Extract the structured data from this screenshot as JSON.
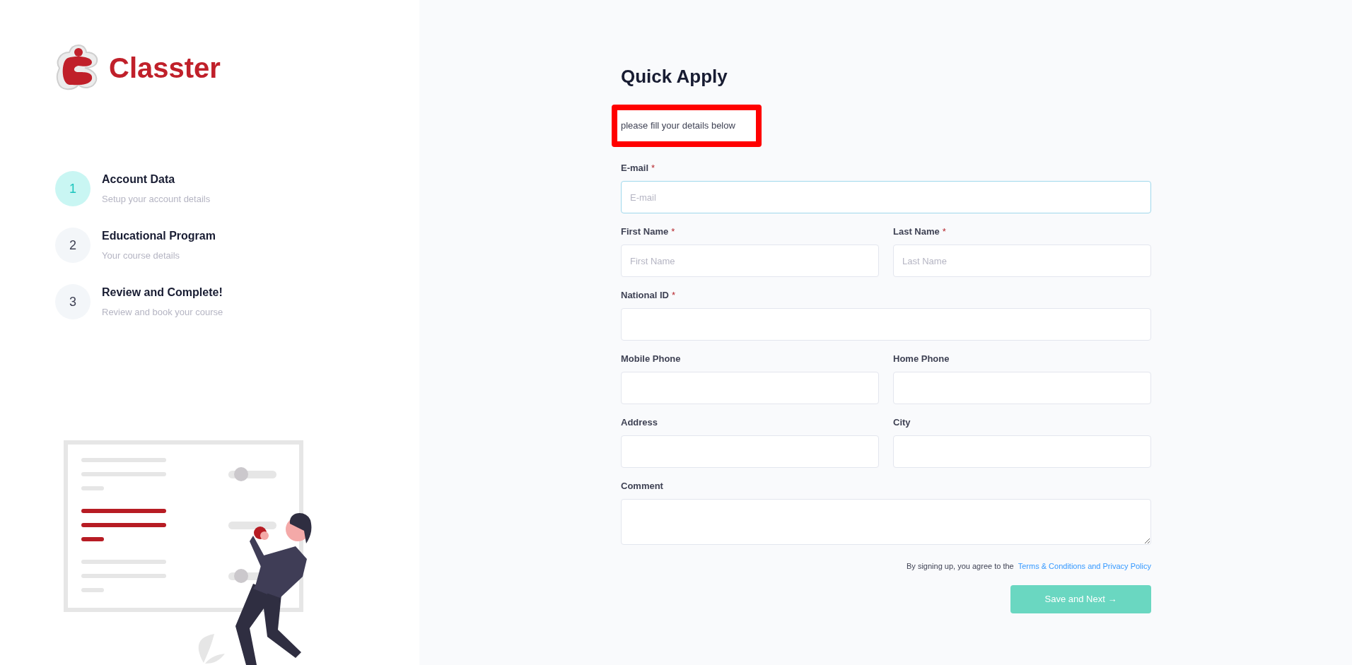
{
  "logo": {
    "text": "Classter"
  },
  "steps": [
    {
      "number": "1",
      "title": "Account Data",
      "subtitle": "Setup your account details",
      "selected": true
    },
    {
      "number": "2",
      "title": "Educational Program",
      "subtitle": "Your course details",
      "selected": false
    },
    {
      "number": "3",
      "title": "Review and Complete!",
      "subtitle": "Review and book your course",
      "selected": false
    }
  ],
  "form": {
    "title": "Quick Apply",
    "note": "please fill your details below",
    "rows": [
      [
        {
          "label": "E-mail",
          "required_mark": "*",
          "placeholder": "E-mail",
          "kind": "input",
          "focused": true
        }
      ],
      [
        {
          "label": "First Name",
          "required_mark": "*",
          "placeholder": "First Name",
          "kind": "input",
          "focused": false
        },
        {
          "label": "Last Name",
          "required_mark": "*",
          "placeholder": "Last Name",
          "kind": "input",
          "focused": false
        }
      ],
      [
        {
          "label": "National ID",
          "required_mark": "*",
          "kind": "input",
          "focused": false
        }
      ],
      [
        {
          "label": "Mobile Phone",
          "kind": "input",
          "focused": false
        },
        {
          "label": "Home Phone",
          "kind": "input",
          "focused": false
        }
      ],
      [
        {
          "label": "Address",
          "kind": "input",
          "focused": false
        },
        {
          "label": "City",
          "kind": "input",
          "focused": false
        }
      ],
      [
        {
          "label": "Comment",
          "kind": "textarea",
          "focused": false
        }
      ]
    ],
    "terms_text": "By signing up, you agree to the",
    "terms_link": "Terms & Conditions and Privacy Policy",
    "submit": {
      "label": "Save and Next →",
      "disabled": true
    }
  }
}
